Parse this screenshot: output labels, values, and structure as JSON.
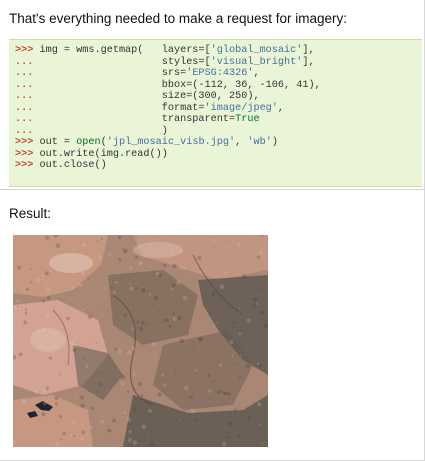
{
  "intro": "That's everything needed to make a request for imagery:",
  "code": {
    "lines": [
      [
        {
          "type": "prompt",
          "text": ">>> "
        },
        {
          "type": "text",
          "text": "img = wms.getmap(   layers=["
        },
        {
          "type": "string",
          "text": "'global_mosaic'"
        },
        {
          "type": "text",
          "text": "],"
        }
      ],
      [
        {
          "type": "prompt",
          "text": "... "
        },
        {
          "type": "text",
          "text": "                    styles=["
        },
        {
          "type": "string",
          "text": "'visual_bright'"
        },
        {
          "type": "text",
          "text": "],"
        }
      ],
      [
        {
          "type": "prompt",
          "text": "... "
        },
        {
          "type": "text",
          "text": "                    srs="
        },
        {
          "type": "string",
          "text": "'EPSG:4326'"
        },
        {
          "type": "text",
          "text": ","
        }
      ],
      [
        {
          "type": "prompt",
          "text": "... "
        },
        {
          "type": "text",
          "text": "                    bbox=(-112, 36, -106, 41),"
        }
      ],
      [
        {
          "type": "prompt",
          "text": "... "
        },
        {
          "type": "text",
          "text": "                    size=(300, 250),"
        }
      ],
      [
        {
          "type": "prompt",
          "text": "... "
        },
        {
          "type": "text",
          "text": "                    format="
        },
        {
          "type": "string",
          "text": "'image/jpeg'"
        },
        {
          "type": "text",
          "text": ","
        }
      ],
      [
        {
          "type": "prompt",
          "text": "... "
        },
        {
          "type": "text",
          "text": "                    transparent="
        },
        {
          "type": "keyword",
          "text": "True"
        }
      ],
      [
        {
          "type": "prompt",
          "text": "... "
        },
        {
          "type": "text",
          "text": "                    )"
        }
      ],
      [
        {
          "type": "prompt",
          "text": ">>> "
        },
        {
          "type": "text",
          "text": "out = "
        },
        {
          "type": "keyword",
          "text": "open"
        },
        {
          "type": "text",
          "text": "("
        },
        {
          "type": "string",
          "text": "'jpl_mosaic_visb.jpg'"
        },
        {
          "type": "text",
          "text": ", "
        },
        {
          "type": "string",
          "text": "'wb'"
        },
        {
          "type": "text",
          "text": ")"
        }
      ],
      [
        {
          "type": "prompt",
          "text": ">>> "
        },
        {
          "type": "text",
          "text": "out.write(img.read())"
        }
      ],
      [
        {
          "type": "prompt",
          "text": ">>> "
        },
        {
          "type": "text",
          "text": "out.close()"
        }
      ]
    ]
  },
  "result_label": "Result:",
  "imagery": {
    "colors": {
      "base": "#a98774",
      "desert": "#c99a84",
      "pink": "#d9a89a",
      "plateau": "#7f6a5c",
      "forest": "#5f5951",
      "bright": "#e2c5b7",
      "water": "#1d2630"
    }
  }
}
